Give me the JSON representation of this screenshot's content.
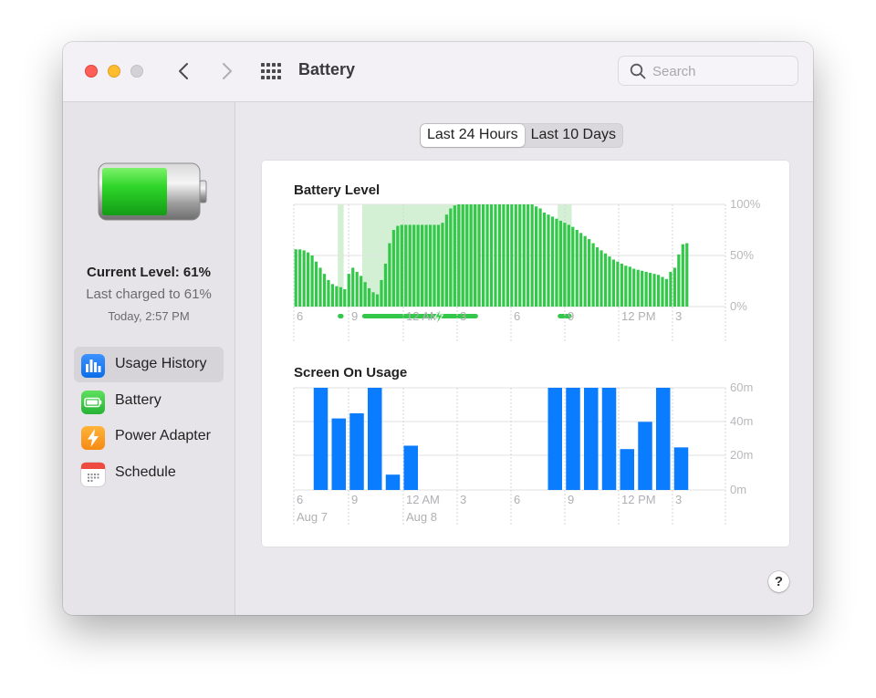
{
  "window": {
    "title": "Battery",
    "search": {
      "placeholder": "Search",
      "value": ""
    }
  },
  "sidebar": {
    "current_level": "Current Level: 61%",
    "last_charged": "Last charged to 61%",
    "charged_time": "Today, 2:57 PM",
    "items": [
      {
        "label": "Usage History",
        "icon": "usage-history-icon",
        "color": "#1f7cf5",
        "active": true
      },
      {
        "label": "Battery",
        "icon": "battery-icon",
        "color": "#34c84a",
        "active": false
      },
      {
        "label": "Power Adapter",
        "icon": "power-adapter-icon",
        "color": "#f5a623",
        "active": false
      },
      {
        "label": "Schedule",
        "icon": "schedule-icon",
        "color": "#ffffff",
        "active": false
      }
    ]
  },
  "tabs": [
    {
      "label": "Last 24 Hours",
      "active": true
    },
    {
      "label": "Last 10 Days",
      "active": false
    }
  ],
  "help_label": "?",
  "chart_data": [
    {
      "type": "bar",
      "title": "Battery Level",
      "y_ticks": [
        "100%",
        "50%",
        "0%"
      ],
      "ylim": [
        0,
        100
      ],
      "x_tick_labels": [
        "6",
        "9",
        "12 AM",
        "3",
        "6",
        "9",
        "12 PM",
        "3"
      ],
      "color": "#34c84a",
      "charging_color": "#d4f0d4",
      "charging_periods_bar_index": [
        [
          11,
          11
        ],
        [
          17,
          44
        ],
        [
          65,
          67
        ]
      ],
      "charging_indicator_color": "#34c84a",
      "values": [
        56,
        56,
        55,
        53,
        50,
        44,
        38,
        32,
        26,
        22,
        20,
        19,
        17,
        32,
        38,
        34,
        30,
        24,
        18,
        14,
        12,
        26,
        42,
        62,
        75,
        79,
        80,
        80,
        80,
        80,
        80,
        80,
        80,
        80,
        80,
        80,
        82,
        90,
        96,
        99,
        100,
        100,
        100,
        100,
        100,
        100,
        100,
        100,
        100,
        100,
        100,
        100,
        100,
        100,
        100,
        100,
        100,
        100,
        100,
        98,
        96,
        92,
        90,
        88,
        86,
        84,
        82,
        80,
        78,
        75,
        72,
        69,
        66,
        62,
        58,
        55,
        52,
        49,
        46,
        44,
        42,
        40,
        39,
        37,
        36,
        35,
        34,
        33,
        32,
        31,
        29,
        27,
        34,
        38,
        51,
        61,
        62
      ]
    },
    {
      "type": "bar",
      "title": "Screen On Usage",
      "y_ticks": [
        "60m",
        "40m",
        "20m",
        "0m"
      ],
      "ylim": [
        0,
        60
      ],
      "x_tick_labels": [
        "6",
        "9",
        "12 AM",
        "3",
        "6",
        "9",
        "12 PM",
        "3"
      ],
      "date_labels": [
        "Aug 7",
        "Aug 8"
      ],
      "color": "#0a7cff",
      "values": [
        0,
        60,
        42,
        45,
        60,
        9,
        26,
        0,
        0,
        0,
        0,
        0,
        0,
        0,
        60,
        60,
        60,
        60,
        24,
        40,
        60,
        25,
        0
      ]
    }
  ]
}
